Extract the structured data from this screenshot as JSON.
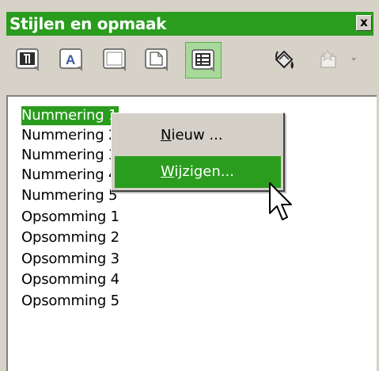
{
  "window": {
    "title": "Stijlen en opmaak",
    "close_label": "x"
  },
  "toolbar": {
    "buttons": [
      {
        "icon": "paragraph-styles-icon",
        "active": false
      },
      {
        "icon": "character-styles-icon",
        "active": false
      },
      {
        "icon": "frame-styles-icon",
        "active": false
      },
      {
        "icon": "page-styles-icon",
        "active": false
      },
      {
        "icon": "list-styles-icon",
        "active": true
      },
      {
        "icon": "fill-format-mode-icon",
        "active": false
      },
      {
        "icon": "new-style-from-selection-icon",
        "active": false
      }
    ]
  },
  "styles_list": {
    "items": [
      "Nummering 1",
      "Nummering 2",
      "Nummering 3",
      "Nummering 4",
      "Nummering 5",
      "Opsomming 1",
      "Opsomming 2",
      "Opsomming 3",
      "Opsomming 4",
      "Opsomming 5"
    ],
    "selected_index": 0
  },
  "context_menu": {
    "new_mnemonic": "N",
    "new_rest": "ieuw ...",
    "modify_mnemonic": "W",
    "modify_rest": "ijzigen..."
  },
  "colors": {
    "accent": "#2a9c1e",
    "highlight_button": "#a7d99b",
    "panel": "#d6d2c8"
  }
}
